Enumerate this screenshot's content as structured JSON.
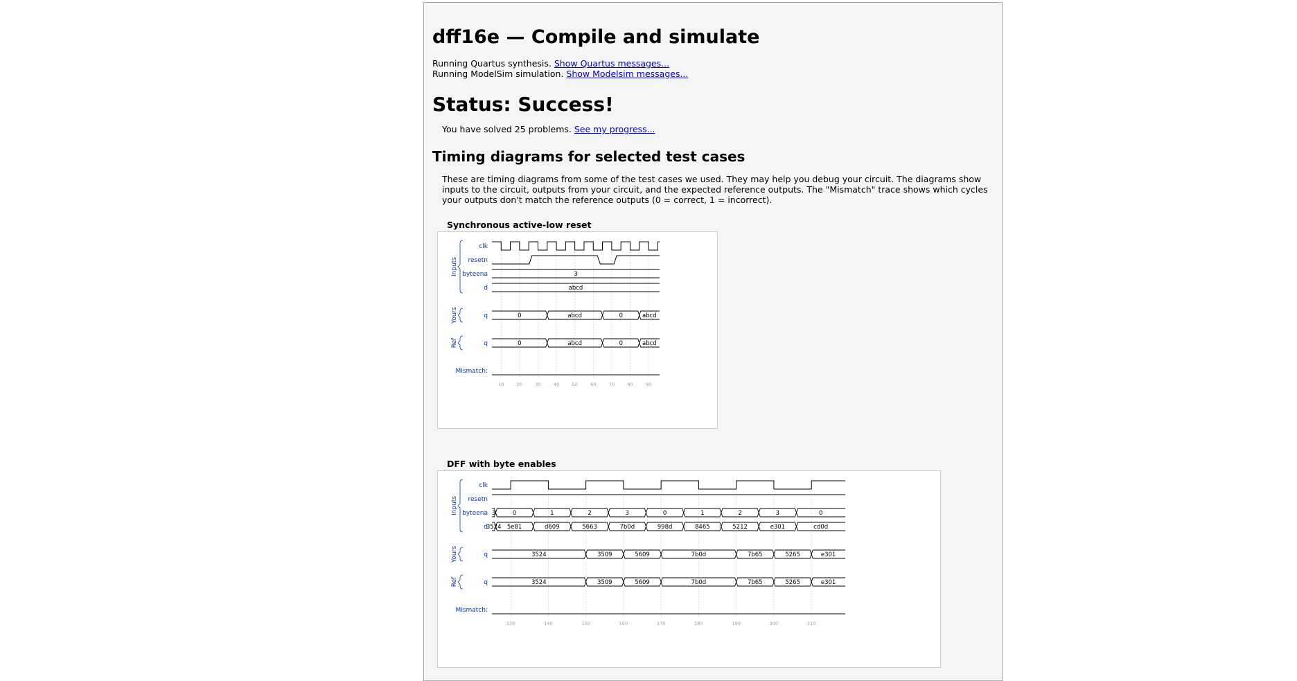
{
  "title": "dff16e — Compile and simulate",
  "messages": [
    {
      "text": "Running Quartus synthesis.",
      "link": "Show Quartus messages..."
    },
    {
      "text": "Running ModelSim simulation.",
      "link": "Show Modelsim messages..."
    }
  ],
  "status": "Status: Success!",
  "solved": {
    "text": "You have solved 25 problems.",
    "link": "See my progress..."
  },
  "timing_heading": "Timing diagrams for selected test cases",
  "timing_desc": "These are timing diagrams from some of the test cases we used. They may help you debug your circuit. The diagrams show inputs to the circuit, outputs from your circuit, and the expected reference outputs. The \"Mismatch\" trace shows which cycles your outputs don't match the reference outputs (0 = correct, 1 = incorrect).",
  "colors": {
    "label": "#0033cc",
    "wire": "#000000",
    "grid": "#cccccc",
    "tick": "#999999"
  },
  "diagrams": [
    {
      "title": "Synchronous active-low reset",
      "group_labels": {
        "inputs": "Inputs",
        "yours": "Yours",
        "ref": "Ref",
        "mismatch": "Mismatch:"
      },
      "time_start": 5,
      "time_end": 96,
      "ticks": [
        10,
        20,
        30,
        40,
        50,
        60,
        70,
        80,
        90
      ],
      "clk": {
        "name": "clk",
        "period": 10,
        "rise_times": [
          5,
          15,
          25,
          35,
          45,
          55,
          65,
          75,
          85,
          95
        ]
      },
      "resetn": {
        "name": "resetn",
        "kind": "bit",
        "edges": [
          [
            5,
            0
          ],
          [
            26,
            1
          ],
          [
            63,
            0
          ],
          [
            72,
            1
          ]
        ]
      },
      "buses": [
        {
          "name": "byteena",
          "group": "inputs",
          "segments": [
            {
              "t": 5,
              "v": "3"
            }
          ]
        },
        {
          "name": "d",
          "group": "inputs",
          "segments": [
            {
              "t": 5,
              "v": "abcd"
            }
          ]
        },
        {
          "name": "q",
          "group": "yours",
          "segments": [
            {
              "t": 5,
              "v": "0"
            },
            {
              "t": 35,
              "v": "abcd"
            },
            {
              "t": 65,
              "v": "0"
            },
            {
              "t": 85,
              "v": "abcd"
            }
          ]
        },
        {
          "name": "q",
          "group": "ref",
          "segments": [
            {
              "t": 5,
              "v": "0"
            },
            {
              "t": 35,
              "v": "abcd"
            },
            {
              "t": 65,
              "v": "0"
            },
            {
              "t": 85,
              "v": "abcd"
            }
          ]
        }
      ]
    },
    {
      "title": "DFF with byte enables",
      "group_labels": {
        "inputs": "Inputs",
        "yours": "Yours",
        "ref": "Ref",
        "mismatch": "Mismatch:"
      },
      "time_start": 125,
      "time_end": 219,
      "ticks": [
        130,
        140,
        150,
        160,
        170,
        180,
        190,
        200,
        210
      ],
      "clk": {
        "name": "clk",
        "period": 20,
        "rise_times": [
          130,
          150,
          170,
          190,
          210
        ]
      },
      "resetn": {
        "name": "resetn",
        "kind": "bit",
        "edges": [
          [
            125,
            1
          ]
        ]
      },
      "buses": [
        {
          "name": "byteena",
          "group": "inputs",
          "segments": [
            {
              "t": 125,
              "v": "3"
            },
            {
              "t": 126,
              "v": "0"
            },
            {
              "t": 136,
              "v": "1"
            },
            {
              "t": 146,
              "v": "2"
            },
            {
              "t": 156,
              "v": "3"
            },
            {
              "t": 166,
              "v": "0"
            },
            {
              "t": 176,
              "v": "1"
            },
            {
              "t": 186,
              "v": "2"
            },
            {
              "t": 196,
              "v": "3"
            },
            {
              "t": 206,
              "v": "0"
            }
          ]
        },
        {
          "name": "d",
          "group": "inputs",
          "segments": [
            {
              "t": 125,
              "v": "3524"
            },
            {
              "t": 126,
              "v": "5e81"
            },
            {
              "t": 136,
              "v": "d609"
            },
            {
              "t": 146,
              "v": "5663"
            },
            {
              "t": 156,
              "v": "7b0d"
            },
            {
              "t": 166,
              "v": "998d"
            },
            {
              "t": 176,
              "v": "8465"
            },
            {
              "t": 186,
              "v": "5212"
            },
            {
              "t": 196,
              "v": "e301"
            },
            {
              "t": 206,
              "v": "cd0d"
            }
          ]
        },
        {
          "name": "q",
          "group": "yours",
          "segments": [
            {
              "t": 125,
              "v": "3524"
            },
            {
              "t": 150,
              "v": "3509"
            },
            {
              "t": 160,
              "v": "5609"
            },
            {
              "t": 170,
              "v": "7b0d"
            },
            {
              "t": 190,
              "v": "7b65"
            },
            {
              "t": 200,
              "v": "5265"
            },
            {
              "t": 210,
              "v": "e301"
            }
          ]
        },
        {
          "name": "q",
          "group": "ref",
          "segments": [
            {
              "t": 125,
              "v": "3524"
            },
            {
              "t": 150,
              "v": "3509"
            },
            {
              "t": 160,
              "v": "5609"
            },
            {
              "t": 170,
              "v": "7b0d"
            },
            {
              "t": 190,
              "v": "7b65"
            },
            {
              "t": 200,
              "v": "5265"
            },
            {
              "t": 210,
              "v": "e301"
            }
          ]
        }
      ]
    }
  ]
}
